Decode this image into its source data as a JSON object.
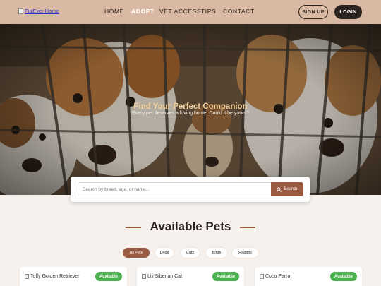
{
  "header": {
    "logo_alt": "FurEver Home",
    "nav": [
      "HOME",
      "ADOPT",
      "VET ACCESS",
      "TIPS",
      "CONTACT"
    ],
    "active_nav": "ADOPT",
    "signup_label": "SIGN UP",
    "login_label": "LOGIN",
    "colors": {
      "header_bg": "#d9b9a3",
      "active": "#ffffff"
    }
  },
  "hero": {
    "title": "Find Your Perfect Companion",
    "subtitle": "Every pet deserves a loving home. Could it be yours?"
  },
  "search": {
    "placeholder": "Search by breed, age, or name...",
    "button_label": "Search",
    "button_icon": "search-icon"
  },
  "section": {
    "title": "Available Pets"
  },
  "filters": [
    "All Pets",
    "Dogs",
    "Cats",
    "Birds",
    "Rabbits"
  ],
  "active_filter": "All Pets",
  "pets": [
    {
      "image_alt": "Toffy Golden Retriever",
      "status": "Available"
    },
    {
      "image_alt": "Lili Siberian Cat",
      "status": "Available"
    },
    {
      "image_alt": "Coco Parrot",
      "status": "Available"
    }
  ],
  "colors": {
    "accent": "#9a5b43",
    "available": "#4caf50",
    "dark": "#2b2320"
  }
}
